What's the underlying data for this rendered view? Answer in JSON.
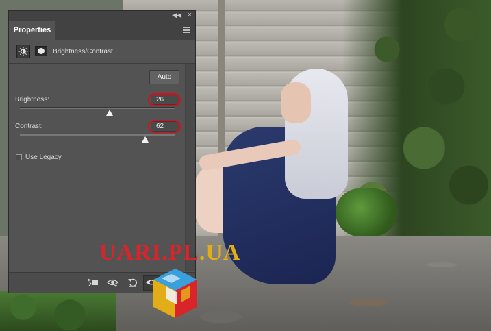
{
  "panel": {
    "tab_label": "Properties",
    "title": "Brightness/Contrast",
    "header_icons": [
      "brightness-contrast-icon",
      "layer-mask-icon"
    ],
    "window_icons": [
      "collapse-panel-icon",
      "close-panel-icon",
      "panel-menu-icon"
    ]
  },
  "controls": {
    "auto_label": "Auto",
    "brightness": {
      "label": "Brightness:",
      "value": "26",
      "slider_fraction": 0.58
    },
    "contrast": {
      "label": "Contrast:",
      "value": "62",
      "slider_fraction": 0.81
    },
    "legacy": {
      "label": "Use Legacy",
      "checked": false
    }
  },
  "footer": {
    "icons": [
      "clip-to-layer-icon",
      "view-previous-state-icon",
      "reset-icon",
      "toggle-visibility-icon",
      "delete-icon"
    ]
  },
  "watermark": {
    "part_a": "UARI.PL",
    "part_b": ".UA"
  },
  "colors": {
    "panel_bg": "#535353",
    "highlight_ring": "#e30a17",
    "watermark_red": "#d9242a",
    "watermark_yellow": "#e3ad19"
  }
}
